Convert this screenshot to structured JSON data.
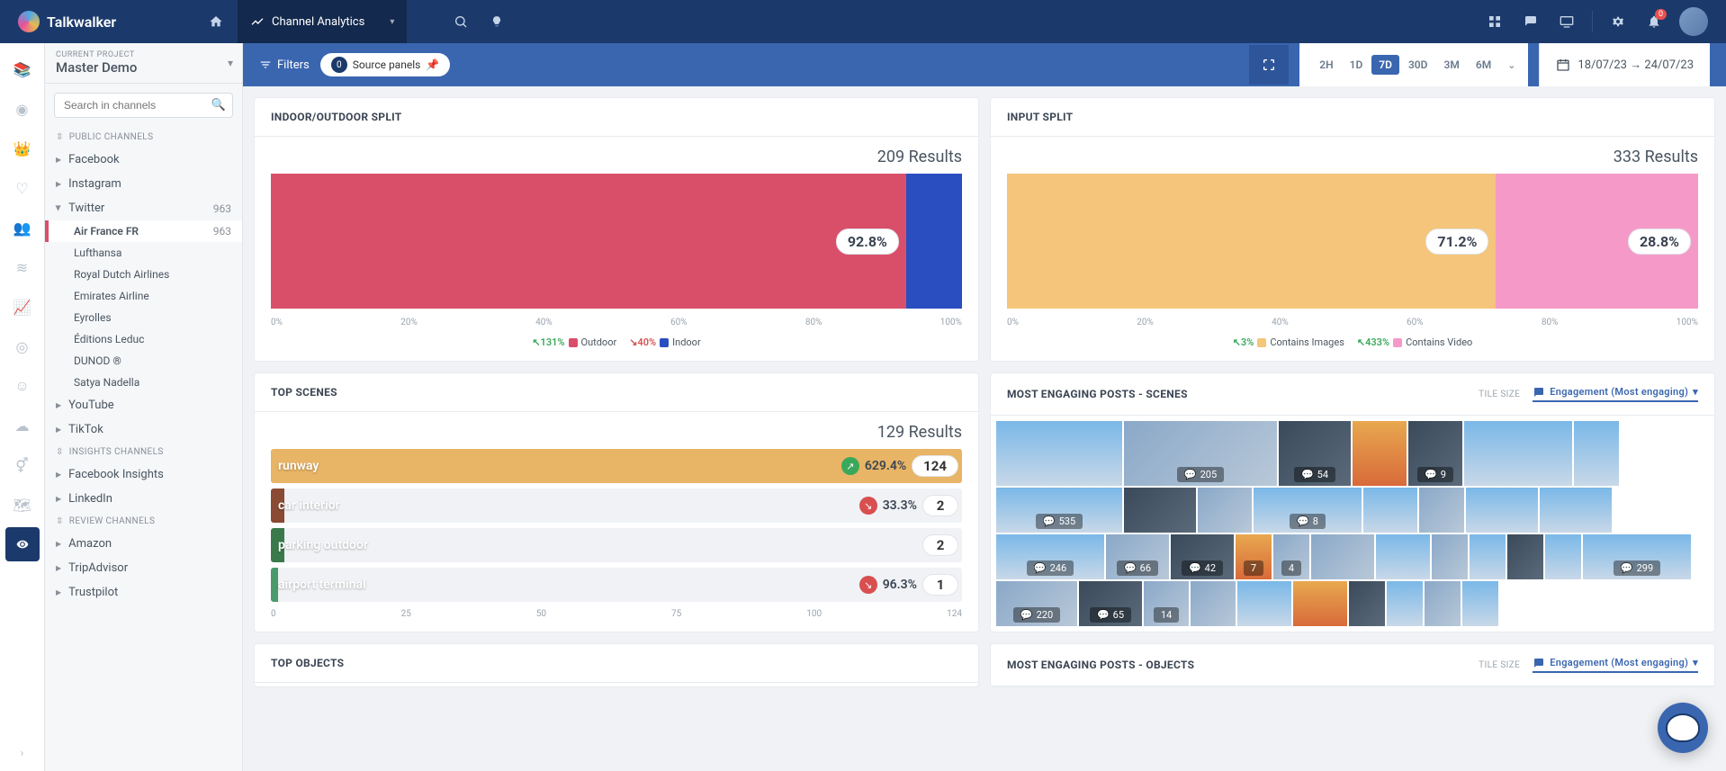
{
  "brand": "Talkwalker",
  "nav": {
    "section": "Channel Analytics"
  },
  "project": {
    "label": "CURRENT PROJECT",
    "name": "Master Demo"
  },
  "search": {
    "placeholder": "Search in channels"
  },
  "channel_sections": {
    "public": "PUBLIC CHANNELS",
    "insights": "INSIGHTS CHANNELS",
    "review": "REVIEW CHANNELS"
  },
  "channels": {
    "facebook": "Facebook",
    "instagram": "Instagram",
    "twitter": {
      "label": "Twitter",
      "count": "963"
    },
    "twitter_subs": [
      {
        "label": "Air France FR",
        "count": "963",
        "active": true
      },
      {
        "label": "Lufthansa"
      },
      {
        "label": "Royal Dutch Airlines"
      },
      {
        "label": "Emirates Airline"
      },
      {
        "label": "Eyrolles"
      },
      {
        "label": "Éditions Leduc"
      },
      {
        "label": "DUNOD ®"
      },
      {
        "label": "Satya Nadella"
      }
    ],
    "youtube": "YouTube",
    "tiktok": "TikTok",
    "fb_insights": "Facebook Insights",
    "linkedin": "LinkedIn",
    "amazon": "Amazon",
    "tripadvisor": "TripAdvisor",
    "trustpilot": "Trustpilot"
  },
  "subheader": {
    "filters": "Filters",
    "source_panels": "Source panels",
    "source_count": "0"
  },
  "time_opts": [
    "2H",
    "1D",
    "7D",
    "30D",
    "3M",
    "6M"
  ],
  "time_active": "7D",
  "date_range": "18/07/23 → 24/07/23",
  "panels": {
    "indoor_outdoor": {
      "title": "INDOOR/OUTDOOR SPLIT",
      "results": "209 Results"
    },
    "input_split": {
      "title": "INPUT SPLIT",
      "results": "333 Results"
    },
    "top_scenes": {
      "title": "TOP SCENES",
      "results": "129 Results"
    },
    "engaging_scenes": {
      "title": "MOST ENGAGING POSTS - SCENES",
      "tile_size": "TILE SIZE",
      "sort": "Engagement (Most engaging)"
    },
    "top_objects": {
      "title": "TOP OBJECTS"
    },
    "engaging_objects": {
      "title": "MOST ENGAGING POSTS - OBJECTS",
      "tile_size": "TILE SIZE",
      "sort": "Engagement (Most engaging)"
    }
  },
  "chart_data": [
    {
      "type": "bar",
      "id": "indoor_outdoor_split",
      "title": "INDOOR/OUTDOOR SPLIT",
      "total_results": 209,
      "orientation": "horizontal-stacked",
      "xlabel": "%",
      "xlim": [
        0,
        100
      ],
      "x_ticks": [
        "0%",
        "20%",
        "40%",
        "60%",
        "80%",
        "100%"
      ],
      "series": [
        {
          "name": "Outdoor",
          "value_pct": 92.8,
          "color": "#d94f6a",
          "trend_pct": 131,
          "trend_dir": "up"
        },
        {
          "name": "Indoor",
          "value_pct": 7.2,
          "color": "#2a4ec0",
          "trend_pct": 40,
          "trend_dir": "down"
        }
      ]
    },
    {
      "type": "bar",
      "id": "input_split",
      "title": "INPUT SPLIT",
      "total_results": 333,
      "orientation": "horizontal-stacked",
      "xlabel": "%",
      "xlim": [
        0,
        100
      ],
      "x_ticks": [
        "0%",
        "20%",
        "40%",
        "60%",
        "80%",
        "100%"
      ],
      "series": [
        {
          "name": "Contains Images",
          "value_pct": 71.2,
          "color": "#f4c57a",
          "trend_pct": 3,
          "trend_dir": "up"
        },
        {
          "name": "Contains Video",
          "value_pct": 28.8,
          "color": "#f59ac8",
          "trend_pct": 433,
          "trend_dir": "up"
        }
      ]
    },
    {
      "type": "bar",
      "id": "top_scenes",
      "title": "TOP SCENES",
      "total_results": 129,
      "orientation": "horizontal",
      "xlim": [
        0,
        124
      ],
      "x_ticks": [
        "0",
        "25",
        "50",
        "75",
        "100",
        "124"
      ],
      "categories": [
        "runway",
        "car interior",
        "parking outdoor",
        "airport terminal"
      ],
      "values": [
        124,
        2,
        2,
        1
      ],
      "meta": [
        {
          "trend_pct": 629.4,
          "trend_dir": "up"
        },
        {
          "trend_pct": 33.3,
          "trend_dir": "down"
        },
        {
          "trend_pct": null,
          "trend_dir": null
        },
        {
          "trend_pct": 96.3,
          "trend_dir": "down"
        }
      ]
    }
  ],
  "engaging_tiles": {
    "counts": [
      "205",
      "54",
      "9",
      "535",
      "8",
      "246",
      "66",
      "42",
      "7",
      "4",
      "299",
      "220",
      "65",
      "14"
    ]
  },
  "notif_count": "0"
}
